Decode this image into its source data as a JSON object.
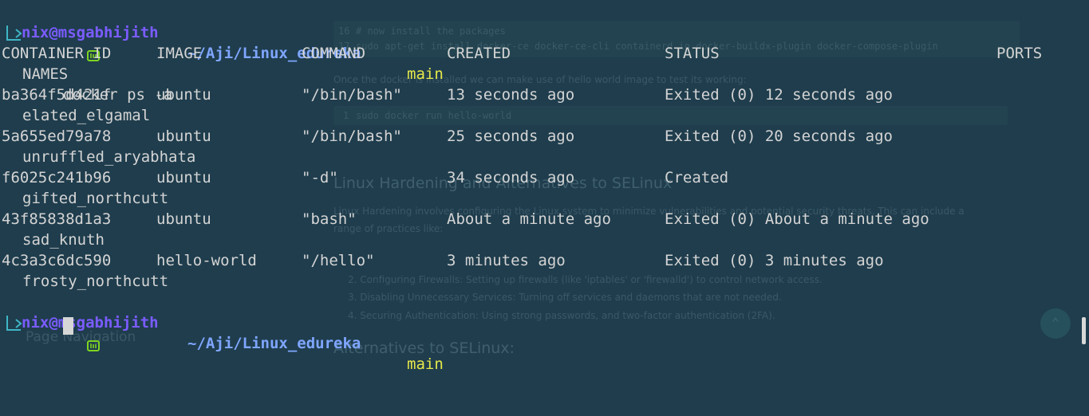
{
  "prompt": {
    "user_host": "nix@msgabhijith",
    "path": "~/Aji/Linux_edureka",
    "branch": "main"
  },
  "command": "docker ps -a",
  "table": {
    "headers": {
      "container_id": "CONTAINER ID",
      "image": "IMAGE",
      "command": "COMMAND",
      "created": "CREATED",
      "status": "STATUS",
      "ports": "PORTS",
      "names": "NAMES"
    },
    "rows": [
      {
        "id": "ba364f5d421f",
        "image": "ubuntu",
        "command": "\"/bin/bash\"",
        "created": "13 seconds ago",
        "status": "Exited (0) 12 seconds ago",
        "name": "elated_elgamal"
      },
      {
        "id": "5a655ed79a78",
        "image": "ubuntu",
        "command": "\"/bin/bash\"",
        "created": "25 seconds ago",
        "status": "Exited (0) 20 seconds ago",
        "name": "unruffled_aryabhata"
      },
      {
        "id": "f6025c241b96",
        "image": "ubuntu",
        "command": "\"-d\"",
        "created": "34 seconds ago",
        "status": "Created",
        "name": "gifted_northcutt"
      },
      {
        "id": "43f85838d1a3",
        "image": "ubuntu",
        "command": "\"bash\"",
        "created": "About a minute ago",
        "status": "Exited (0) About a minute ago",
        "name": "sad_knuth"
      },
      {
        "id": "4c3a3c6dc590",
        "image": "hello-world",
        "command": "\"/hello\"",
        "created": "3 minutes ago",
        "status": "Exited (0) 3 minutes ago",
        "name": "frosty_northcutt"
      }
    ]
  },
  "background_page": {
    "code_line_16_num": "16",
    "code_line_16": "# now install the packages",
    "code_line_17_num": "17",
    "code_line_17": "sudo apt-get install docker-ce docker-ce-cli containerd.io docker-buildx-plugin docker-compose-plugin",
    "paragraph_1": "Once the docker is installed we can make use of hello world image to test its working:",
    "code2_num": "1",
    "code2": "sudo docker run hello-world",
    "heading_1": "Linux Hardening and Alternatives to SELinux",
    "paragraph_2a": "Linux Hardening involves configuring the Linux system to minimize vulnerabilities and potential security threats. This can include a",
    "paragraph_2b": "range of practices like:",
    "list_item_2": "2. Configuring Firewalls: Setting up firewalls (like 'iptables' or 'firewalld') to control network access.",
    "list_item_3": "3. Disabling Unnecessary Services: Turning off services and daemons that are not needed.",
    "list_item_4": "4. Securing Authentication: Using strong passwords, and two-factor authentication (2FA).",
    "heading_2": "Alternatives to SELinux:",
    "sidebar_label": "Page Navigation"
  },
  "colors": {
    "background": "#1f3d4d",
    "prompt_user": "#7b5cff",
    "prompt_path": "#7fa6ff",
    "prompt_branch": "#e6e84a",
    "arrow": "#3fb6c6",
    "mint_icon": "#7ed321"
  }
}
